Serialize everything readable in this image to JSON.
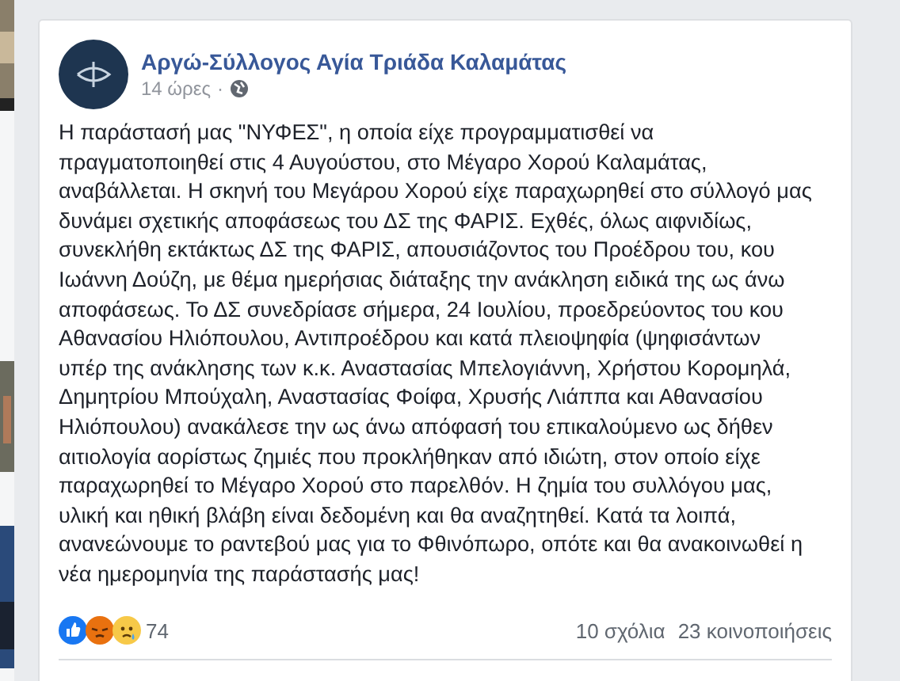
{
  "post": {
    "author": "Αργώ-Σύλλογος Αγία Τριάδα Καλαμάτας",
    "time": "14 ώρες",
    "separator": "·",
    "lines": [
      "Η παράστασή μας \"ΝΥΦΕΣ\", η οποία είχε προγραμματισθεί να",
      "πραγματοποιηθεί στις 4 Αυγούστου, στο Μέγαρο Χορού Καλαμάτας,",
      "αναβάλλεται. Η σκηνή του Μεγάρου Χορού είχε παραχωρηθεί στο σύλλογό μας",
      "δυνάμει σχετικής αποφάσεως του ΔΣ της ΦΑΡΙΣ. Εχθές, όλως αιφνιδίως,",
      "συνεκλήθη εκτάκτως ΔΣ της ΦΑΡΙΣ, απουσιάζοντος του Προέδρου του, κου",
      "Ιωάννη Δούζη, με θέμα ημερήσιας διάταξης την ανάκληση ειδικά της ως άνω",
      "αποφάσεως. Το ΔΣ συνεδρίασε σήμερα, 24 Ιουλίου, προεδρεύοντος του κου",
      "Αθανασίου Ηλιόπουλου, Αντιπροέδρου και κατά πλειοψηφία (ψηφισάντων",
      "υπέρ της ανάκλησης των κ.κ. Αναστασίας Μπελογιάννη, Χρήστου Κορομηλά,",
      "Δημητρίου Μπούχαλη, Αναστασίας Φοίφα, Χρυσής Λιάππα και Αθανασίου",
      "Ηλιόπουλου) ανακάλεσε την ως άνω απόφασή του επικαλούμενο ως δήθεν",
      "αιτιολογία αορίστως ζημιές που προκλήθηκαν από ιδιώτη, στον οποίο είχε",
      "παραχωρηθεί το Μέγαρο Χορού στο παρελθόν. Η ζημία του συλλόγου μας,",
      "υλική και ηθική βλάβη είναι δεδομένη και θα αναζητηθεί. Κατά τα λοιπά,",
      "ανανεώνουμε το ραντεβού μας για το Φθινόπωρο, οπότε και θα ανακοινωθεί η",
      "νέα ημερομηνία της παράστασής μας!"
    ],
    "reactions": [
      {
        "kind": "like"
      },
      {
        "kind": "angry"
      },
      {
        "kind": "sad"
      }
    ],
    "reaction_count": "74",
    "comments": "10 σχόλια",
    "shares": "23 κοινοποιήσεις"
  }
}
